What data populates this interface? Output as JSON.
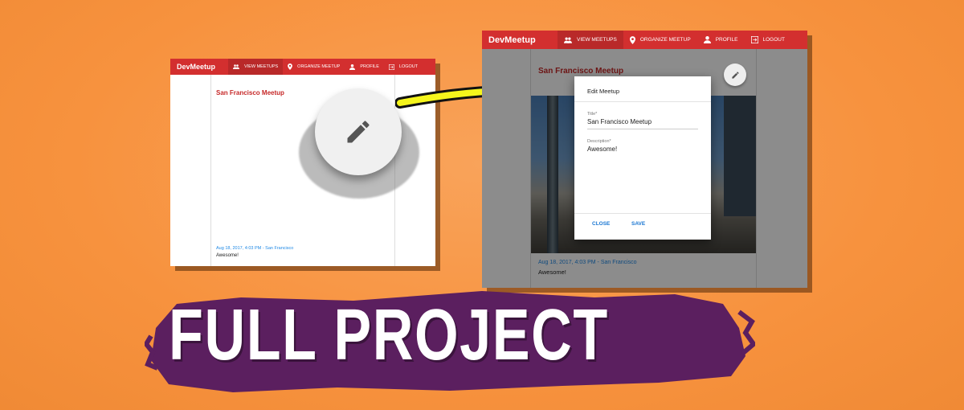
{
  "left_screenshot": {
    "app_title": "DevMeetup",
    "nav": [
      {
        "label": "VIEW MEETUPS",
        "icon": "people-icon",
        "active": true
      },
      {
        "label": "ORGANIZE MEETUP",
        "icon": "location-pin-icon",
        "active": false
      },
      {
        "label": "PROFILE",
        "icon": "person-icon",
        "active": false
      },
      {
        "label": "LOGOUT",
        "icon": "exit-icon",
        "active": false
      }
    ],
    "meetup": {
      "title": "San Francisco Meetup",
      "info": "Aug 18, 2017, 4:03 PM - San Francisco",
      "description": "Awesome!"
    },
    "fab_icon": "pencil-icon"
  },
  "right_screenshot": {
    "app_title": "DevMeetup",
    "nav": [
      {
        "label": "VIEW MEETUPS",
        "icon": "people-icon",
        "active": true
      },
      {
        "label": "ORGANIZE MEETUP",
        "icon": "location-pin-icon",
        "active": false
      },
      {
        "label": "PROFILE",
        "icon": "person-icon",
        "active": false
      },
      {
        "label": "LOGOUT",
        "icon": "exit-icon",
        "active": false
      }
    ],
    "meetup": {
      "title": "San Francisco Meetup",
      "info": "Aug 18, 2017, 4:03 PM - San Francisco",
      "description": "Awesome!"
    },
    "dialog": {
      "title": "Edit Meetup",
      "title_label": "Title*",
      "title_value": "San Francisco Meetup",
      "description_label": "Description*",
      "description_value": "Awesome!",
      "close_label": "CLOSE",
      "save_label": "SAVE"
    }
  },
  "banner": {
    "text": "FULL PROJECT"
  },
  "colors": {
    "background": "#f7923e",
    "toolbar": "#d32f2f",
    "meetup_title": "#c62828",
    "link": "#1e88e5",
    "banner": "#5b1f5f",
    "arrow": "#f5f51c"
  }
}
